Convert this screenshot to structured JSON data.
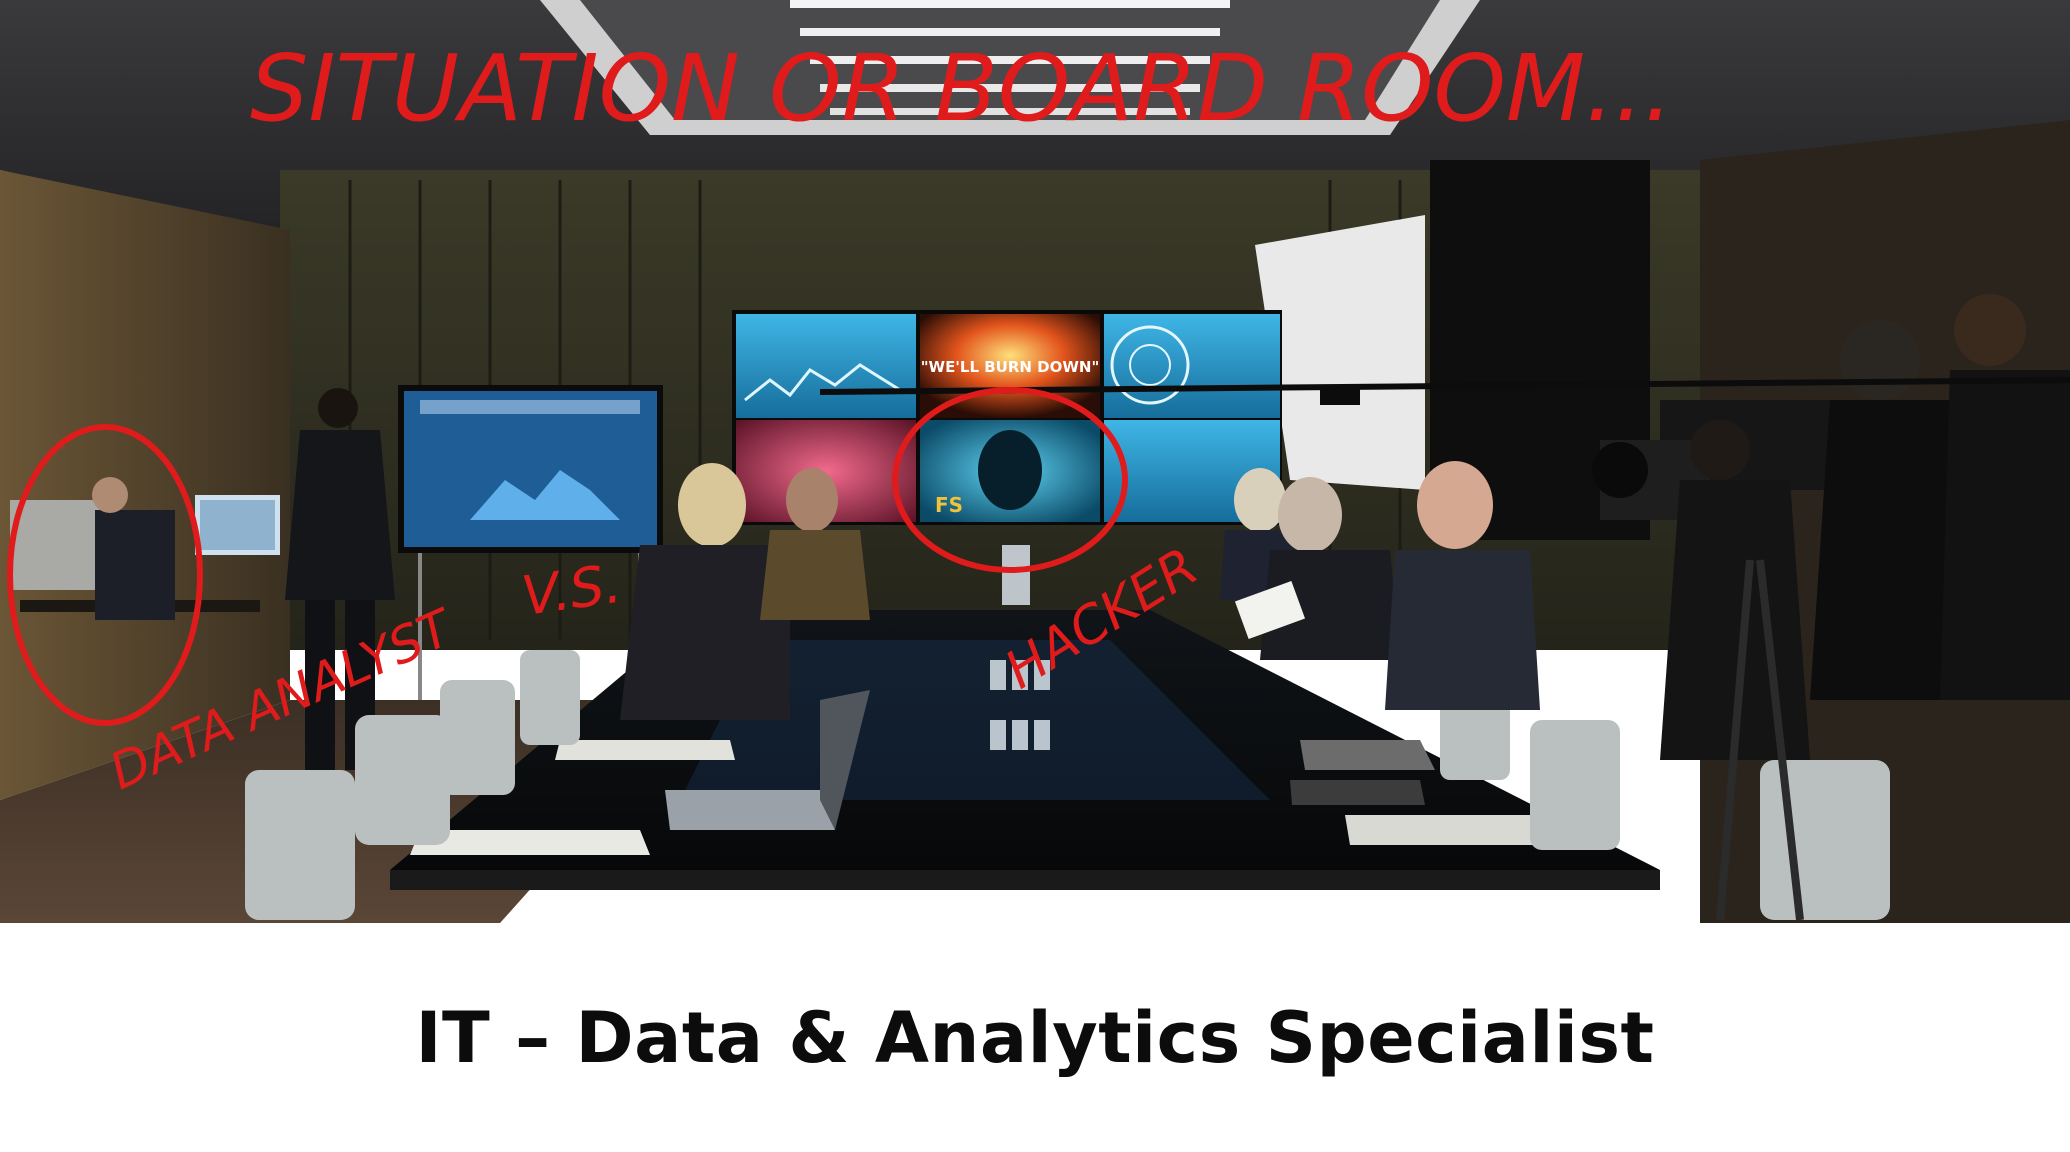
{
  "photo": {
    "annotations": {
      "title_note": "SITUATION OR BOARD ROOM...",
      "analyst_note": "DATA ANALYST",
      "vs_note": "V.S.",
      "hacker_note": "HACKER"
    },
    "screen_text": {
      "video_wall_quote": "\"WE'LL BURN DOWN\"",
      "hacker_logo": "FS"
    },
    "ink_color": "#e01b1b"
  },
  "caption": {
    "title": "IT – Data & Analytics Specialist"
  }
}
